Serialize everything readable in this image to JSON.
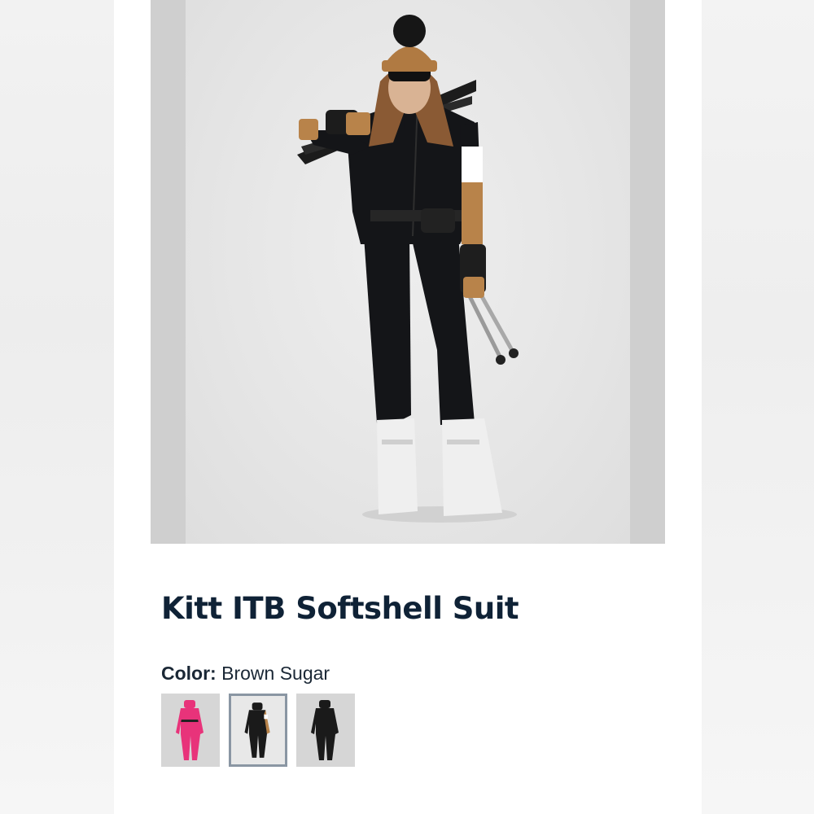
{
  "product": {
    "title": "Kitt ITB Softshell Suit",
    "color_label": "Color:",
    "color_value": "Brown Sugar"
  },
  "hero_image": {
    "icon": "product-model-image"
  },
  "swatches": [
    {
      "name": "pink",
      "color": "#e8337a",
      "selected": false
    },
    {
      "name": "brown-sugar",
      "color": "#1a1a1a",
      "accent": "#b8834a",
      "selected": true
    },
    {
      "name": "black",
      "color": "#1a1a1a",
      "selected": false
    }
  ],
  "colors": {
    "title": "#0f2236",
    "suit": "#141518",
    "accent_tan": "#b8834a",
    "boots": "#efefef"
  }
}
